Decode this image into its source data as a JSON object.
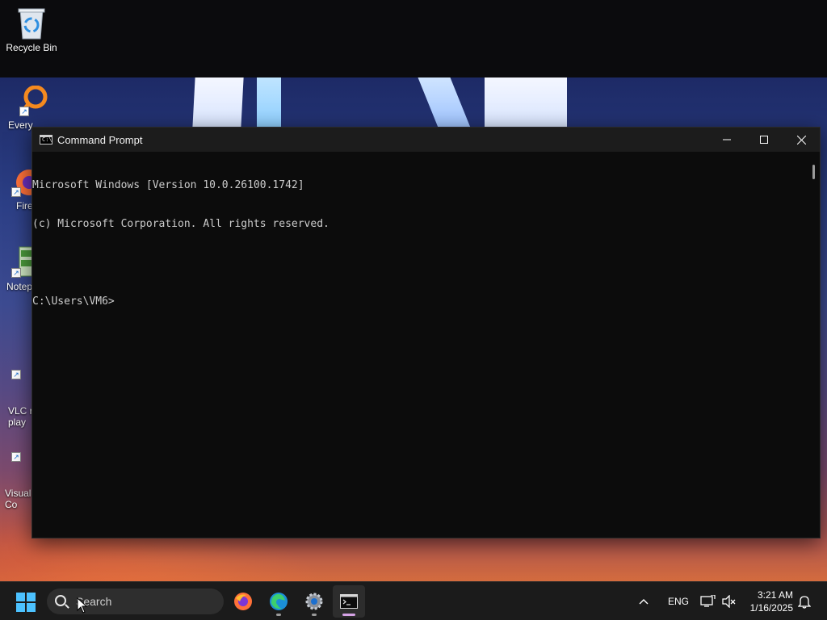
{
  "desktop": {
    "icons": [
      {
        "label": "Recycle Bin"
      },
      {
        "label": "Every"
      },
      {
        "label": "Fire"
      },
      {
        "label": "Notep"
      },
      {
        "label": "VLC r\nplay"
      },
      {
        "label": "Visual\nCo"
      }
    ]
  },
  "cmd_window": {
    "title": "Command Prompt",
    "lines": [
      "Microsoft Windows [Version 10.0.26100.1742]",
      "(c) Microsoft Corporation. All rights reserved.",
      "",
      "C:\\Users\\VM6>"
    ],
    "controls": {
      "minimize": "—",
      "maximize": "☐",
      "close": "✕"
    }
  },
  "taskbar": {
    "search_placeholder": "Search",
    "apps": [
      {
        "name": "Firefox",
        "icon": "firefox-icon"
      },
      {
        "name": "Microsoft Edge",
        "icon": "edge-icon"
      },
      {
        "name": "Settings",
        "icon": "gear-icon"
      },
      {
        "name": "Command Prompt",
        "icon": "terminal-icon",
        "active": true
      }
    ],
    "tray": {
      "language": "ENG",
      "time": "3:21 AM",
      "date": "1/16/2025"
    }
  },
  "colors": {
    "accent": "#4cc2ff",
    "cmd_bg": "#0c0c0c",
    "cmd_text": "#cccccc",
    "taskbar_bg": "#1b1b1b"
  }
}
